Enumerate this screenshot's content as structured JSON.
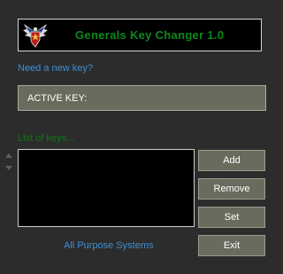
{
  "banner": {
    "title": "Generals Key Changer 1.0",
    "logo_icon": "eagle-star-emblem-icon",
    "title_color": "#0a8a1a"
  },
  "links": {
    "new_key": "Need a new key?",
    "company": "All Purpose Systems"
  },
  "active_key": {
    "label": "ACTIVE KEY:"
  },
  "key_list": {
    "label": "List of keys...",
    "items": [],
    "scroll_up_icon": "triangle-up-icon",
    "scroll_down_icon": "triangle-down-icon"
  },
  "buttons": {
    "add": "Add",
    "remove": "Remove",
    "set": "Set",
    "exit": "Exit"
  },
  "colors": {
    "background": "#2c2c2c",
    "panel": "#696c5d",
    "link": "#3d8fd6",
    "green_text": "#0e7a16"
  }
}
